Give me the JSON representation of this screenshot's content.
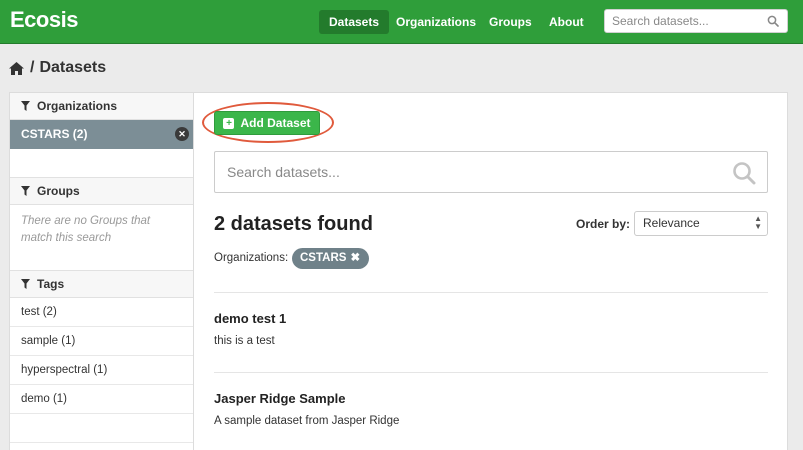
{
  "navbar": {
    "brand": "Ecosis",
    "links": [
      "Datasets",
      "Organizations",
      "Groups",
      "About"
    ],
    "search_placeholder": "Search datasets..."
  },
  "breadcrumb": {
    "separator": "/",
    "current": "Datasets"
  },
  "sidebar": {
    "organizations": {
      "title": "Organizations",
      "selected": "CSTARS (2)"
    },
    "groups": {
      "title": "Groups",
      "empty_message": "There are no Groups that match this search"
    },
    "tags": {
      "title": "Tags",
      "items": [
        "test (2)",
        "sample (1)",
        "hyperspectral (1)",
        "demo (1)"
      ]
    }
  },
  "main": {
    "add_button": "Add Dataset",
    "search_placeholder": "Search datasets...",
    "result_count": "2 datasets found",
    "order_label": "Order by:",
    "order_value": "Relevance",
    "filter_label": "Organizations:",
    "filter_pill": "CSTARS",
    "datasets": [
      {
        "title": "demo test 1",
        "description": "this is a test"
      },
      {
        "title": "Jasper Ridge Sample",
        "description": "A sample dataset from Jasper Ridge"
      }
    ]
  },
  "colors": {
    "brand_green": "#2f9e3a",
    "button_green": "#3bb64a",
    "selected_org": "#7c8e96",
    "highlight_ring": "#e05a3c"
  },
  "icons": [
    "search-icon",
    "home-icon",
    "filter-icon",
    "remove-icon",
    "plus-icon",
    "caret-icon"
  ]
}
